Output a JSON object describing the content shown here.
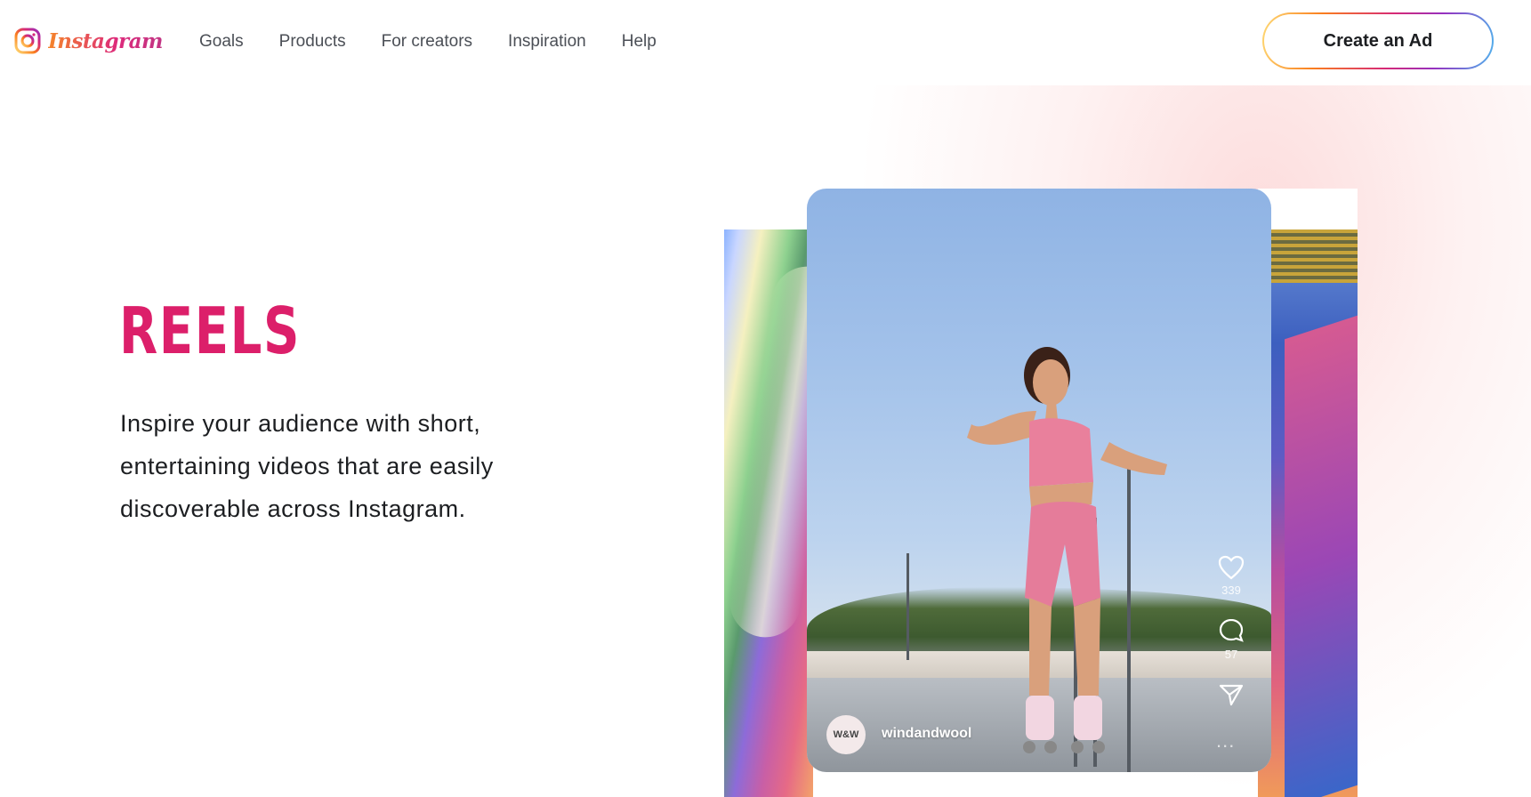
{
  "header": {
    "logo_text": "Instagram",
    "nav": [
      {
        "label": "Goals"
      },
      {
        "label": "Products"
      },
      {
        "label": "For creators"
      },
      {
        "label": "Inspiration"
      },
      {
        "label": "Help"
      }
    ],
    "cta_label": "Create an Ad"
  },
  "hero": {
    "title": "REELS",
    "description": "Inspire your audience with short, entertaining videos that are easily discoverable across Instagram."
  },
  "reel": {
    "likes": "339",
    "comments": "57",
    "avatar_text": "W&W",
    "username": "windandwool",
    "more": "..."
  },
  "colors": {
    "title": "#dc1f6a",
    "text": "#1c1e21",
    "nav": "#4b4f56"
  },
  "icons": [
    "instagram-logo-icon",
    "heart-icon",
    "comment-icon",
    "share-icon",
    "more-icon"
  ]
}
